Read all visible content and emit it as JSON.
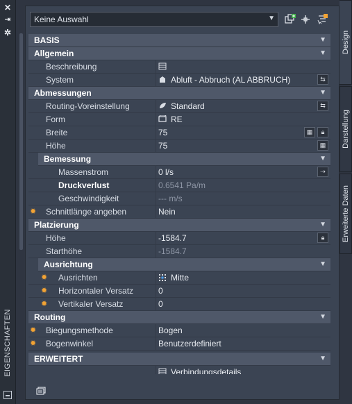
{
  "sidebar": {
    "title": "EIGENSCHAFTEN"
  },
  "toolbar": {
    "selection_value": "Keine Auswahl",
    "icons": [
      "select-objects-icon",
      "pick-add-icon",
      "quick-select-icon",
      "close-icon",
      "pin-icon",
      "settings-icon"
    ]
  },
  "tabs": [
    "Design",
    "Darstellung",
    "Erweiterte Daten"
  ],
  "sections": {
    "basis": "BASIS",
    "allgemein": "Allgemein",
    "abmessungen": "Abmessungen",
    "bemessung": "Bemessung",
    "platzierung": "Platzierung",
    "ausrichtung": "Ausrichtung",
    "routing": "Routing",
    "erweitert": "ERWEITERT"
  },
  "props": {
    "beschreibung": {
      "label": "Beschreibung",
      "value": ""
    },
    "system": {
      "label": "System",
      "value": "Abluft - Abbruch (AL ABBRUCH)"
    },
    "routing_voreinstellung": {
      "label": "Routing-Voreinstellung",
      "value": "Standard"
    },
    "form": {
      "label": "Form",
      "value": "RE"
    },
    "breite": {
      "label": "Breite",
      "value": "75"
    },
    "hoehe_abm": {
      "label": "Höhe",
      "value": "75"
    },
    "massenstrom": {
      "label": "Massenstrom",
      "value": "0 l/s"
    },
    "druckverlust": {
      "label": "Druckverlust",
      "value": "0.6541 Pa/m"
    },
    "geschwindigkeit": {
      "label": "Geschwindigkeit",
      "value": "--- m/s"
    },
    "schnittlaenge": {
      "label": "Schnittlänge angeben",
      "value": "Nein"
    },
    "hoehe_plat": {
      "label": "Höhe",
      "value": "-1584.7"
    },
    "starthoehe": {
      "label": "Starthöhe",
      "value": "-1584.7"
    },
    "ausrichten": {
      "label": "Ausrichten",
      "value": "Mitte"
    },
    "horiz_versatz": {
      "label": "Horizontaler Versatz",
      "value": "0"
    },
    "vert_versatz": {
      "label": "Vertikaler Versatz",
      "value": "0"
    },
    "biegungsmethode": {
      "label": "Biegungsmethode",
      "value": "Bogen"
    },
    "bogenwinkel": {
      "label": "Bogenwinkel",
      "value": "Benutzerdefiniert"
    },
    "verbindungsdetails": {
      "label": "",
      "value": "Verbindungsdetails"
    }
  },
  "colors": {
    "accent_star": "#f2a334",
    "panel_bg": "#3b4453",
    "header_bg": "#4f5869"
  }
}
